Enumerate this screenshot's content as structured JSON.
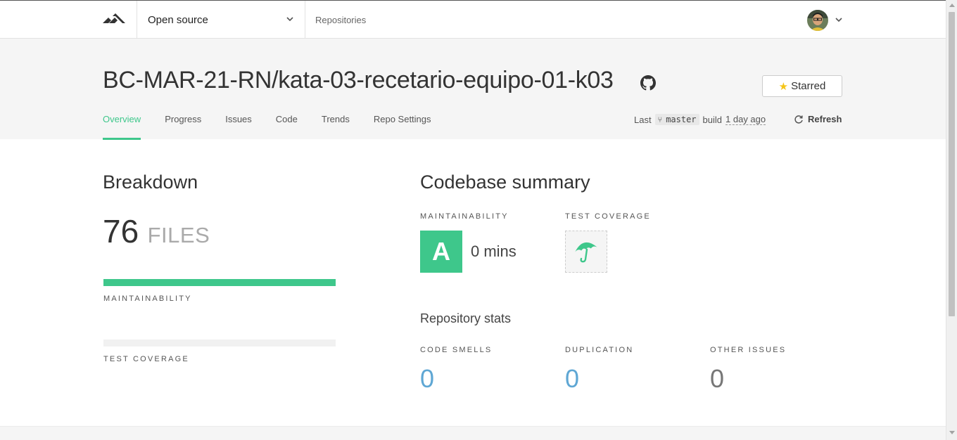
{
  "topnav": {
    "logo_icon": "codeclimate-logo-icon",
    "org_selector_label": "Open source",
    "repositories_link": "Repositories",
    "user_avatar": "user-avatar"
  },
  "repo": {
    "name": "BC-MAR-21-RN/kata-03-recetario-equipo-01-k03",
    "github_icon": "github-icon",
    "starred_label": "Starred"
  },
  "tabs": [
    {
      "label": "Overview",
      "active": true
    },
    {
      "label": "Progress",
      "active": false
    },
    {
      "label": "Issues",
      "active": false
    },
    {
      "label": "Code",
      "active": false
    },
    {
      "label": "Trends",
      "active": false
    },
    {
      "label": "Repo Settings",
      "active": false
    }
  ],
  "build": {
    "prefix": "Last",
    "branch": "master",
    "middle": "build",
    "time": "1 day ago",
    "refresh_label": "Refresh"
  },
  "breakdown": {
    "title": "Breakdown",
    "file_count": "76",
    "file_unit": "FILES",
    "maintainability_label": "MAINTAINABILITY",
    "maintainability_fraction": 1.0,
    "test_coverage_label": "TEST COVERAGE",
    "test_coverage_fraction": 0
  },
  "summary": {
    "title": "Codebase summary",
    "maintainability_label": "MAINTAINABILITY",
    "grade": "A",
    "grade_time": "0 mins",
    "test_coverage_label": "TEST COVERAGE",
    "coverage_icon": "umbrella-icon",
    "stats_title": "Repository stats",
    "stats": [
      {
        "label": "CODE SMELLS",
        "value": "0"
      },
      {
        "label": "DUPLICATION",
        "value": "0"
      },
      {
        "label": "OTHER ISSUES",
        "value": "0"
      }
    ]
  },
  "colors": {
    "accent_green": "#3ec78b",
    "link_blue": "#5fa7d4",
    "star_yellow": "#f5c518"
  }
}
